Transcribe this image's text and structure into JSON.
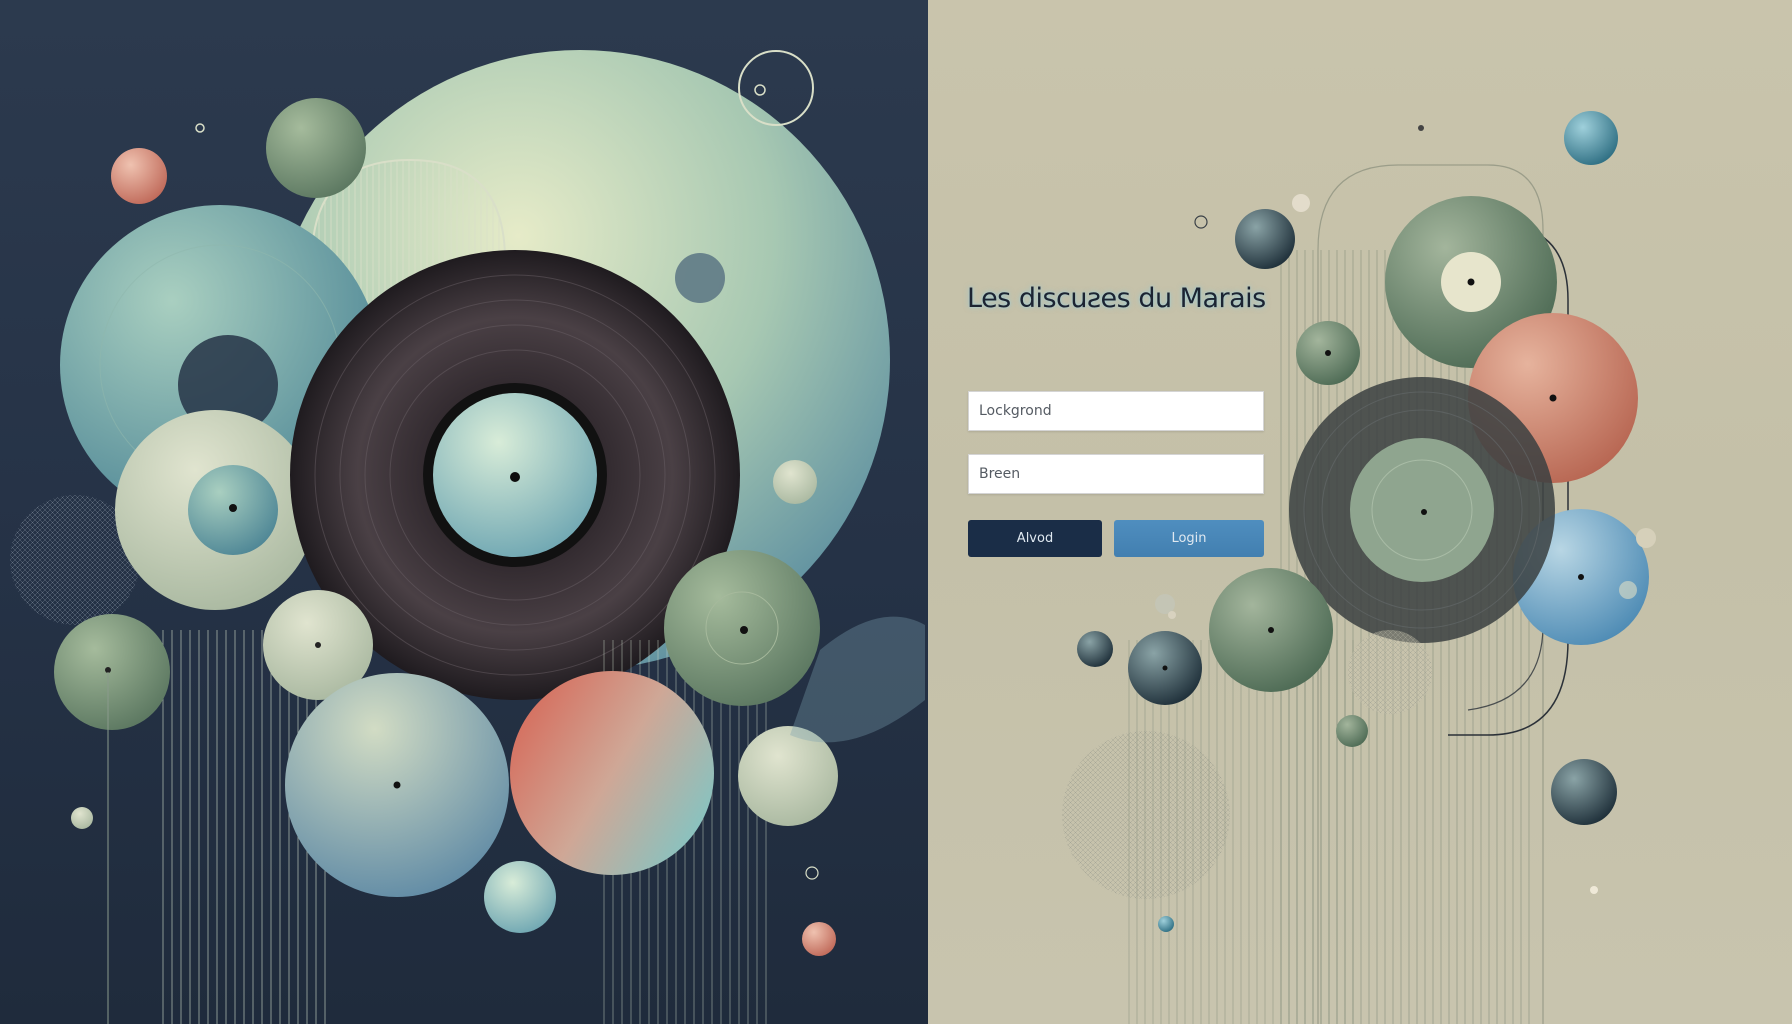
{
  "app": {
    "title": "Les discuƨes du Marais"
  },
  "login_form": {
    "field_1_value": "Lockgrond",
    "field_2_value": "Breen",
    "primary_button_label": "Alvod",
    "secondary_button_label": "Login"
  },
  "colors": {
    "left_background": "#263447",
    "right_background": "#c9c4ac",
    "primary_button": "#1a2d47",
    "secondary_button": "#4a88ba",
    "accent_teal": "#7fb3b0",
    "accent_sage": "#7f9a82",
    "accent_coral": "#d27f68"
  }
}
